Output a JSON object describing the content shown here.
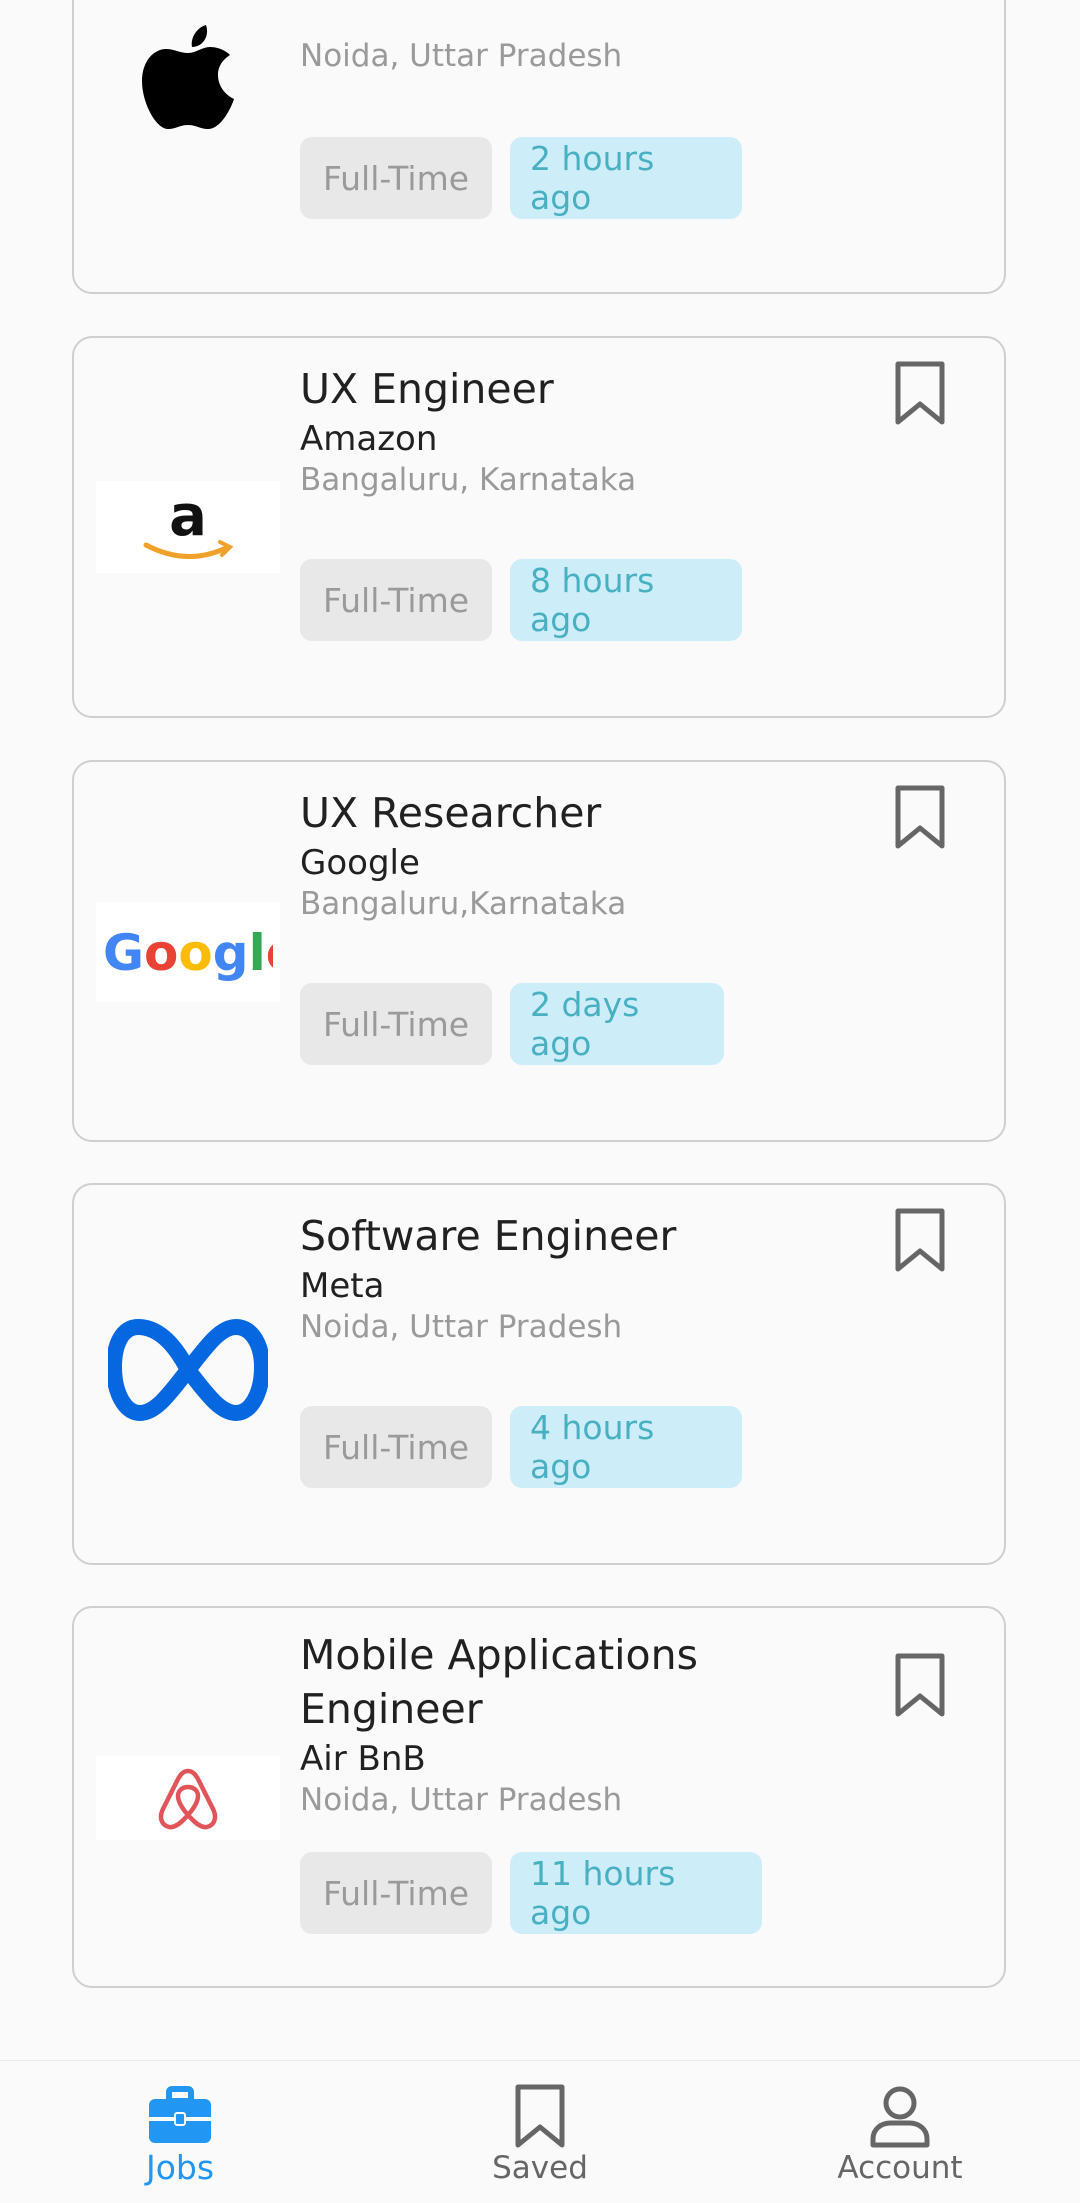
{
  "jobs": [
    {
      "company_logo": "apple-logo",
      "location": "Noida, Uttar Pradesh",
      "type": "Full-Time",
      "posted": "2 hours ago"
    },
    {
      "title": "UX Engineer",
      "company": "Amazon",
      "company_logo": "amazon-logo",
      "location": "Bangaluru, Karnataka",
      "type": "Full-Time",
      "posted": "8 hours ago"
    },
    {
      "title": "UX Researcher",
      "company": "Google",
      "company_logo": "google-logo",
      "location": "Bangaluru,Karnataka",
      "type": "Full-Time",
      "posted": "2 days ago"
    },
    {
      "title": "Software Engineer",
      "company": "Meta",
      "company_logo": "meta-logo",
      "location": "Noida, Uttar Pradesh",
      "type": "Full-Time",
      "posted": "4 hours ago"
    },
    {
      "title": "Mobile Applications Engineer",
      "company": "Air BnB",
      "company_logo": "airbnb-logo",
      "location": "Noida, Uttar Pradesh",
      "type": "Full-Time",
      "posted": "11 hours ago"
    }
  ],
  "nav": {
    "items": [
      {
        "label": "Jobs",
        "icon": "briefcase-icon",
        "active": true
      },
      {
        "label": "Saved",
        "icon": "bookmark-icon",
        "active": false
      },
      {
        "label": "Account",
        "icon": "person-icon",
        "active": false
      }
    ]
  },
  "colors": {
    "accent": "#2196f3",
    "time_chip_bg": "#cdeef8",
    "time_chip_text": "#49b0c2",
    "type_chip_bg": "#e8e8e8"
  }
}
